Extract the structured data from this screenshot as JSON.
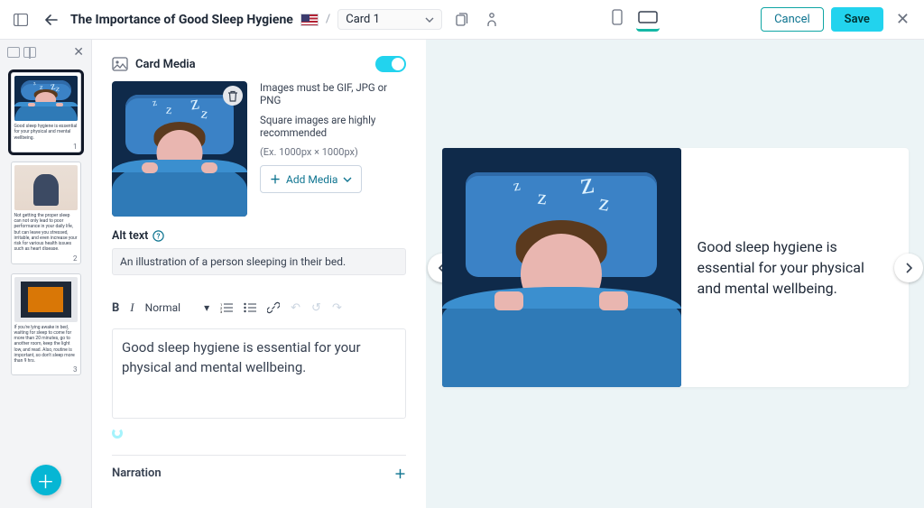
{
  "header": {
    "doc_title": "The Importance of Good Sleep Hygiene",
    "card_select": "Card 1",
    "cancel": "Cancel",
    "save": "Save"
  },
  "sidebar": {
    "thumbs": [
      {
        "caption": "Good sleep hygiene is essential for your physical and mental wellbeing.",
        "num": "1"
      },
      {
        "caption": "Not getting the proper sleep can not only lead to poor performance in your daily life, but can leave you stressed, irritable, and even increase your risk for various health issues such as heart disease.",
        "num": "2"
      },
      {
        "caption": "If you're lying awake in bed, waiting for sleep to come for more than 20 minutes, go to another room, keep the light low, and read. Also, routine is important, so don't sleep more than 9 hrs.",
        "num": "3"
      }
    ]
  },
  "editor": {
    "card_media_label": "Card Media",
    "req_text": "Images must be GIF, JPG or PNG",
    "rec_text": "Square images are highly recommended",
    "hint_text": "(Ex. 1000px × 1000px)",
    "add_media": "Add Media",
    "alt_label": "Alt text",
    "alt_value": "An illustration of a person sleeping in their bed.",
    "style_select": "Normal",
    "body_text": "Good sleep hygiene is essential for your physical and mental wellbeing.",
    "narration_label": "Narration"
  },
  "preview": {
    "text": "Good sleep hygiene is essential for your physical and mental wellbeing."
  }
}
